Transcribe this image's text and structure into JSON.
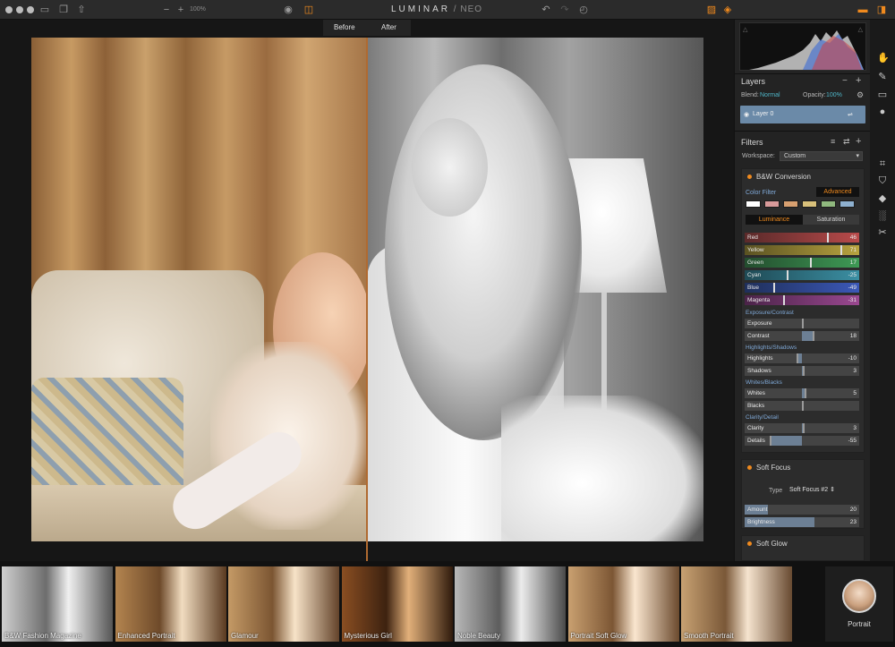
{
  "app": {
    "brand": "LUMINAR",
    "brand_sub": "NEO",
    "zoom": "100%"
  },
  "colors": {
    "accent": "#f08a1e",
    "layer_selected": "#6b8aa8",
    "teal": "#4fb6c8"
  },
  "canvas": {
    "before_label": "Before",
    "after_label": "After"
  },
  "layers": {
    "title": "Layers",
    "blend_label": "Blend:",
    "blend_value": "Normal",
    "opacity_label": "Opacity:",
    "opacity_value": "100%",
    "layer_name": "Layer 0"
  },
  "filters": {
    "title": "Filters",
    "workspace_label": "Workspace:",
    "workspace_value": "Custom",
    "bw": {
      "title": "B&W Conversion",
      "color_filter_label": "Color Filter",
      "advanced_label": "Advanced",
      "tabs": [
        "Luminance",
        "Saturation"
      ],
      "channels": [
        {
          "label": "Red",
          "value": "46",
          "level": 0.73
        },
        {
          "label": "Yellow",
          "value": "71",
          "level": 0.85
        },
        {
          "label": "Green",
          "value": "17",
          "level": 0.58
        },
        {
          "label": "Cyan",
          "value": "-25",
          "level": 0.37
        },
        {
          "label": "Blue",
          "value": "-49",
          "level": 0.25
        },
        {
          "label": "Magenta",
          "value": "-31",
          "level": 0.34
        }
      ],
      "groups": [
        {
          "head": "Exposure/Contrast",
          "sliders": [
            {
              "label": "Exposure",
              "value": "",
              "level": 0.5
            },
            {
              "label": "Contrast",
              "value": "18",
              "level": 0.59
            }
          ]
        },
        {
          "head": "Highlights/Shadows",
          "sliders": [
            {
              "label": "Highlights",
              "value": "-10",
              "level": 0.45
            },
            {
              "label": "Shadows",
              "value": "3",
              "level": 0.51
            }
          ]
        },
        {
          "head": "Whites/Blacks",
          "sliders": [
            {
              "label": "Whites",
              "value": "5",
              "level": 0.52
            },
            {
              "label": "Blacks",
              "value": "",
              "level": 0.5
            }
          ]
        },
        {
          "head": "Clarity/Detail",
          "sliders": [
            {
              "label": "Clarity",
              "value": "3",
              "level": 0.51
            },
            {
              "label": "Details",
              "value": "-55",
              "level": 0.22
            }
          ]
        }
      ]
    },
    "soft_focus": {
      "title": "Soft Focus",
      "type_label": "Type",
      "type_value": "Soft Focus #2",
      "sliders": [
        {
          "label": "Amount",
          "value": "20",
          "level": 0.2
        },
        {
          "label": "Brightness",
          "value": "23",
          "level": 0.61
        }
      ]
    },
    "soft_glow": {
      "title": "Soft Glow"
    }
  },
  "presets": [
    {
      "label": "B&W Fashion Magazine"
    },
    {
      "label": "Enhanced Portrait"
    },
    {
      "label": "Glamour"
    },
    {
      "label": "Mysterious Girl"
    },
    {
      "label": "Noble Beauty"
    },
    {
      "label": "Portrait Soft Glow"
    },
    {
      "label": "Smooth Portrait"
    }
  ],
  "category": {
    "label": "Portrait"
  }
}
